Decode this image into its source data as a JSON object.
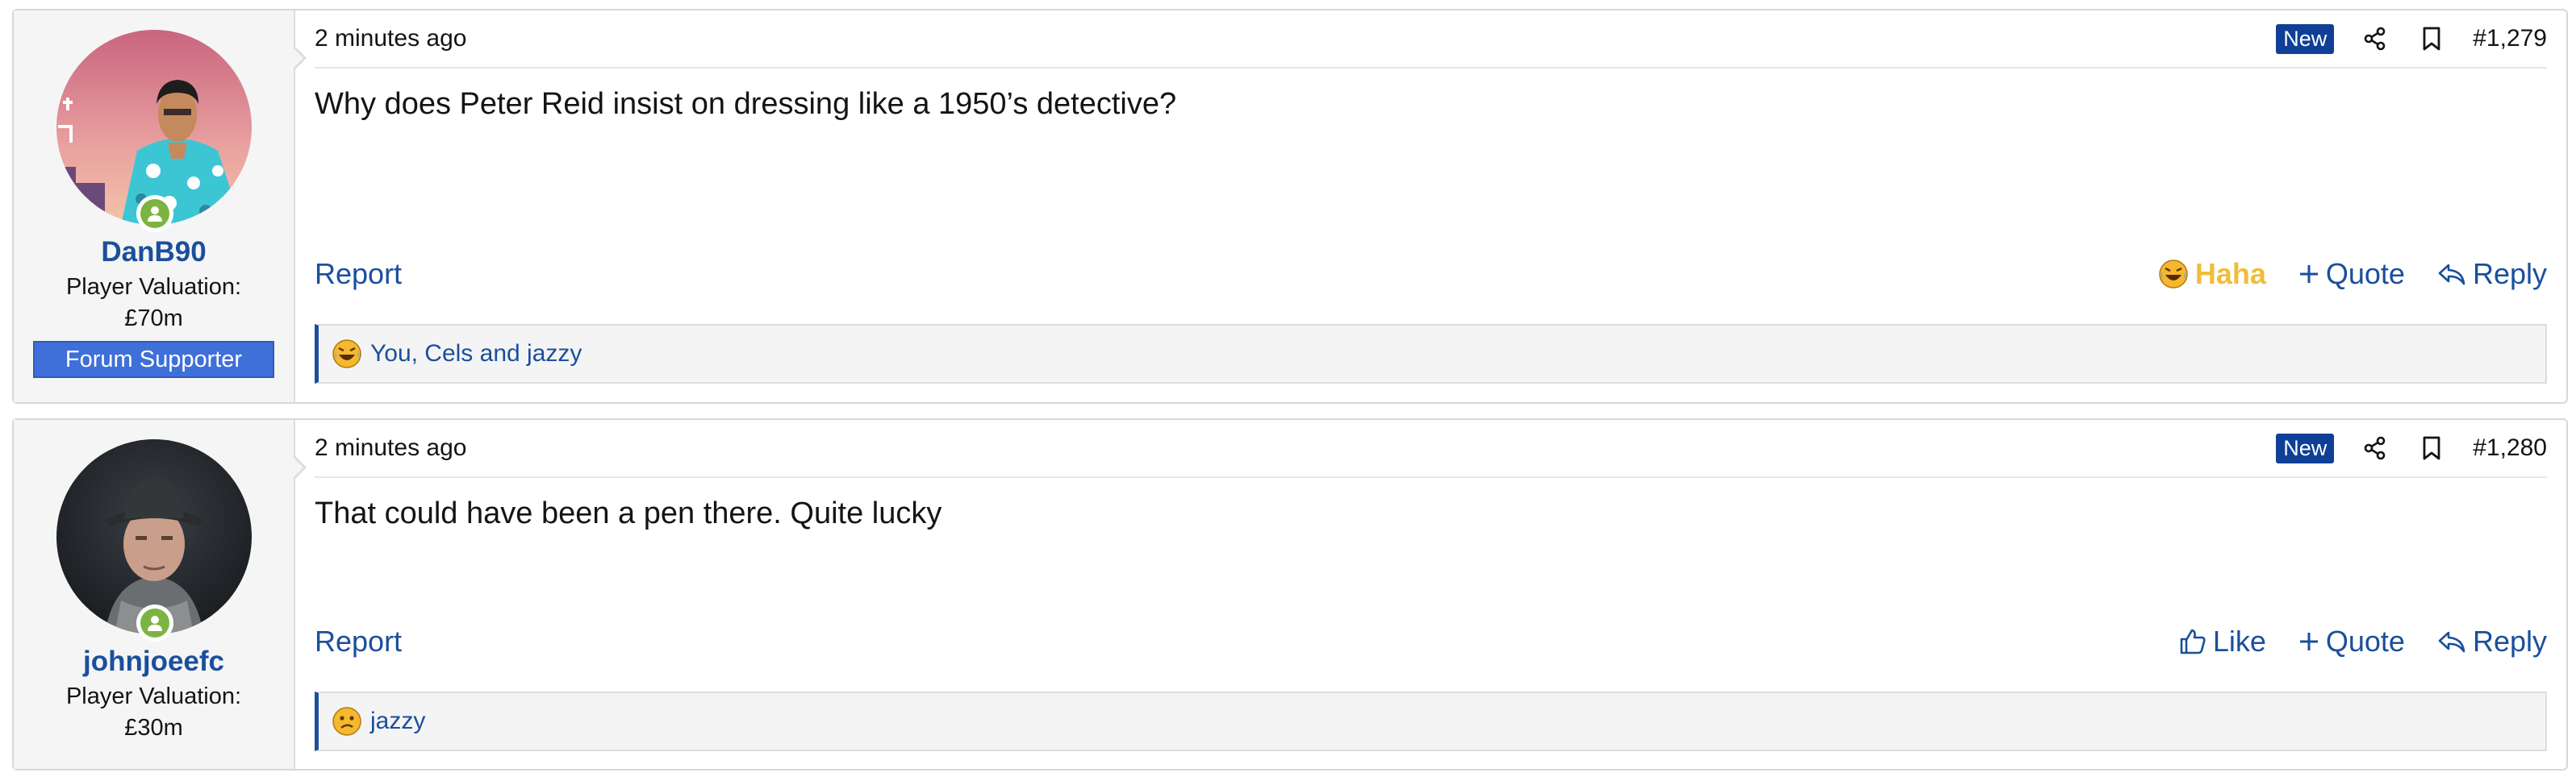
{
  "posts": [
    {
      "username": "DanB90",
      "valuation_line1": "Player Valuation:",
      "valuation_line2": "£70m",
      "banner": "Forum Supporter",
      "time": "2 minutes ago",
      "new_label": "New",
      "number": "#1,279",
      "body": "Why does Peter Reid insist on dressing like a 1950’s detective?",
      "report_label": "Report",
      "reaction_button_label": "Haha",
      "quote_label": "Quote",
      "reply_label": "Reply",
      "reactions_text": "You, Cels and jazzy",
      "reaction_icon": "laughing-emoji-icon"
    },
    {
      "username": "johnjoeefc",
      "valuation_line1": "Player Valuation:",
      "valuation_line2": "£30m",
      "time": "2 minutes ago",
      "new_label": "New",
      "number": "#1,280",
      "body": "That could have been a pen there. Quite lucky",
      "report_label": "Report",
      "reaction_button_label": "Like",
      "quote_label": "Quote",
      "reply_label": "Reply",
      "reactions_text": "jazzy",
      "reaction_icon": "confused-emoji-icon"
    }
  ],
  "colors": {
    "link": "#1a4f9c",
    "new_badge": "#0f3f97",
    "banner": "#3f6fd8",
    "online": "#7cb342",
    "haha": "#f0bd3a"
  }
}
